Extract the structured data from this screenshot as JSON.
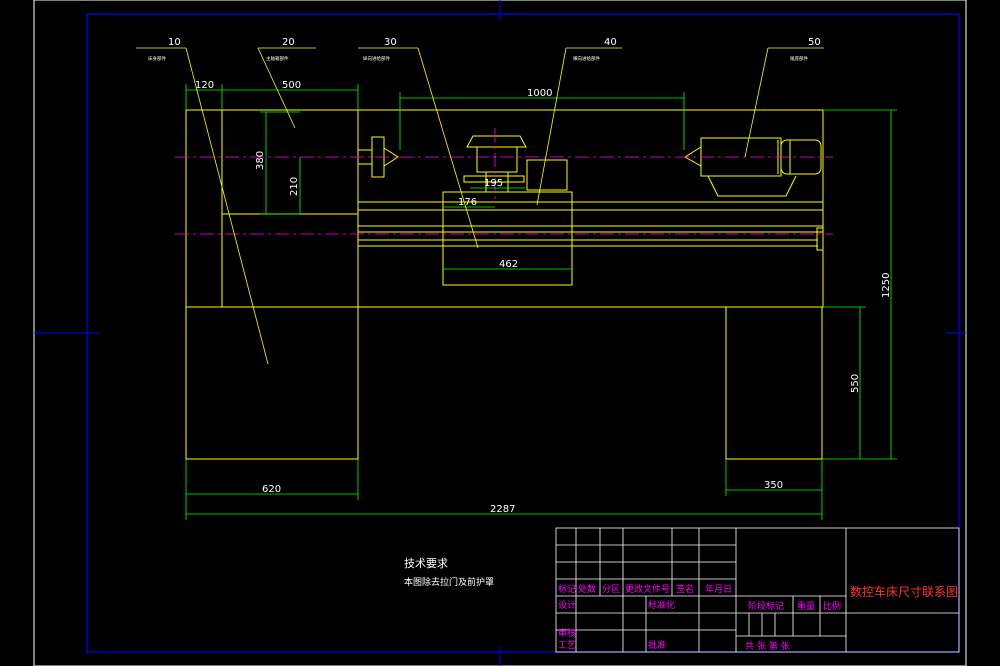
{
  "drawing": {
    "title": "数控车床尺寸联系图",
    "tech_requirements": {
      "heading": "技术要求",
      "note": "本图除去拉门及前护罩"
    },
    "parts": [
      {
        "id": "p10",
        "num": "10",
        "label": "床身部件"
      },
      {
        "id": "p20",
        "num": "20",
        "label": "主轴箱部件"
      },
      {
        "id": "p30",
        "num": "30",
        "label": "纵向进给部件"
      },
      {
        "id": "p40",
        "num": "40",
        "label": "横向进给部件"
      },
      {
        "id": "p50",
        "num": "50",
        "label": "尾座部件"
      }
    ],
    "dimensions": {
      "d120": "120",
      "d500": "500",
      "d1000": "1000",
      "d380": "380",
      "d210": "210",
      "d195": "195",
      "d176": "176",
      "d462": "462",
      "d1250": "1250",
      "d550": "550",
      "d620": "620",
      "d350": "350",
      "d2287": "2287"
    },
    "title_block": {
      "row_labels": [
        "标记",
        "处数",
        "分区",
        "更改文件号",
        "签名",
        "年月日"
      ],
      "design": "设计",
      "standardize": "标准化",
      "review": "审核",
      "process": "工艺",
      "approve": "批准",
      "stage_mark": "阶段标记",
      "weight": "重量",
      "scale": "比例",
      "sheets": "共   张   第   张"
    }
  },
  "colors": {
    "frame": "#0000ff",
    "outline": "#ffff00",
    "dimension": "#00ff00",
    "centerline": "#ff00ff",
    "text": "#ffffff",
    "title": "#ff3333"
  }
}
